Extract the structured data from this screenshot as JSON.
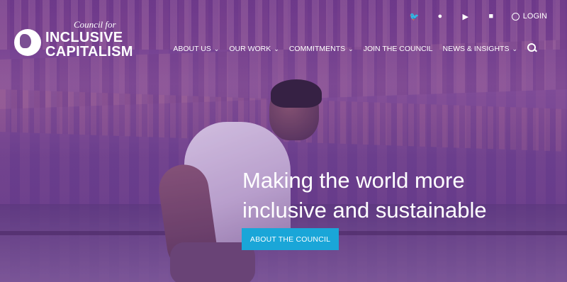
{
  "logo": {
    "small_text": "Council for",
    "line1": "INCLUSIVE",
    "line2": "CAPITALISM"
  },
  "topbar": {
    "social_icons": [
      "twitter-icon",
      "facebook-icon",
      "youtube-icon",
      "linkedin-icon"
    ],
    "login_label": "LOGIN"
  },
  "nav": {
    "items": [
      {
        "label": "ABOUT US",
        "dropdown": true
      },
      {
        "label": "OUR WORK",
        "dropdown": true
      },
      {
        "label": "COMMITMENTS",
        "dropdown": true
      },
      {
        "label": "JOIN THE COUNCIL",
        "dropdown": false
      },
      {
        "label": "NEWS & INSIGHTS",
        "dropdown": true
      }
    ]
  },
  "hero": {
    "headline_line1": "Making the world more",
    "headline_line2": "inclusive and sustainable",
    "cta_label": "ABOUT THE COUNCIL"
  },
  "colors": {
    "overlay": "#6a2f9a",
    "cta": "#1aa6d8"
  }
}
